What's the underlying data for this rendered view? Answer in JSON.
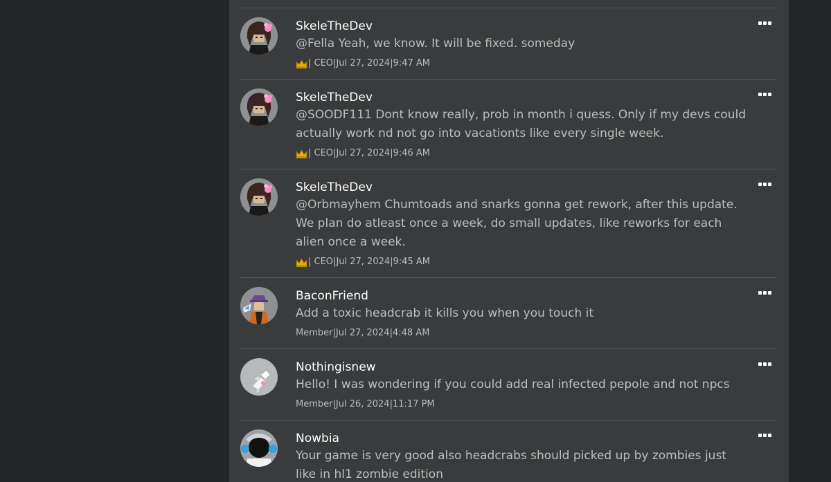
{
  "comments": [
    {
      "username": "SkeleTheDev",
      "text": "@Fella Yeah, we know. It will be fixed. someday",
      "role": "| CEO",
      "date": "Jul 27, 2024",
      "time": "9:47 AM",
      "badge": "crown-icon",
      "avatar": "skele"
    },
    {
      "username": "SkeleTheDev",
      "text": "@SOODF111 Dont know really, prob in month i quess. Only if my devs could actually work nd not go into vacationts like every single week.",
      "role": "| CEO",
      "date": "Jul 27, 2024",
      "time": "9:46 AM",
      "badge": "crown-icon",
      "avatar": "skele"
    },
    {
      "username": "SkeleTheDev",
      "text": "@Orbmayhem Chumtoads and snarks gonna get rework, after this update. We plan do atleast once a week, do small updates, like reworks for each alien once a week.",
      "role": "| CEO",
      "date": "Jul 27, 2024",
      "time": "9:45 AM",
      "badge": "crown-icon",
      "avatar": "skele"
    },
    {
      "username": "BaconFriend",
      "text": "Add a toxic headcrab it kills you when you touch it",
      "role": "Member",
      "date": "Jul 27, 2024",
      "time": "4:48 AM",
      "badge": null,
      "avatar": "bacon"
    },
    {
      "username": "Nothingisnew",
      "text": "Hello! I was wondering if you could add real infected pepole and not npcs",
      "role": "Member",
      "date": "Jul 26, 2024",
      "time": "11:17 PM",
      "badge": null,
      "avatar": "nothing"
    },
    {
      "username": "Nowbia",
      "text": "Your game is very good also headcrabs should picked up by zombies just like in hl1 zombie edition",
      "role": "",
      "date": "",
      "time": "",
      "badge": null,
      "avatar": "nowbia"
    }
  ],
  "meta_separator": " | ",
  "colors": {
    "page_bg": "#232527",
    "panel_bg": "#393b3d",
    "divider": "#55585b",
    "username": "#ffffff",
    "text": "#bdbebe",
    "avatar_bg": "#8e9194"
  }
}
